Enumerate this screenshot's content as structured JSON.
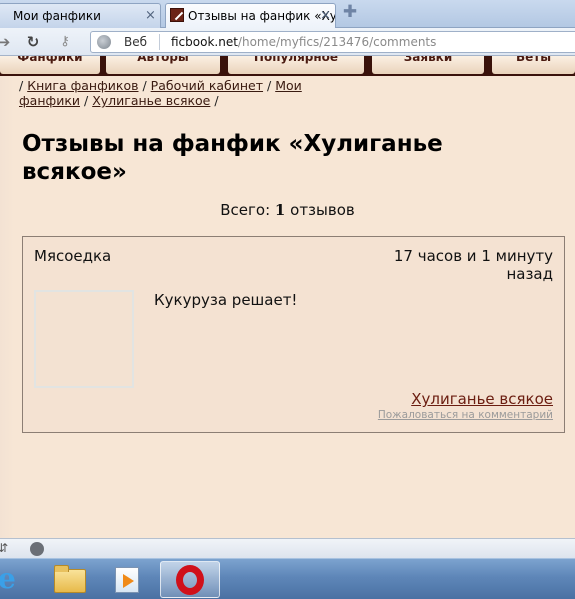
{
  "browser": {
    "tabs": [
      {
        "title": "Мои фанфики",
        "close": "×"
      },
      {
        "title": "Отзывы на фанфик «Хулиганье всякое»",
        "close": "×"
      }
    ],
    "new_tab": "✚",
    "address": {
      "mode_label": "Веб",
      "domain": "ficbook.net",
      "path": "/home/myfics/213476/comments"
    }
  },
  "site_nav": {
    "items": [
      {
        "label": "Фанфики"
      },
      {
        "label": "Авторы"
      },
      {
        "label": "Популярное"
      },
      {
        "label": "Заявки"
      },
      {
        "label": "Беты"
      }
    ]
  },
  "breadcrumb": {
    "sep": "/",
    "items": [
      "Книга фанфиков",
      "Рабочий кабинет",
      "Мои фанфики",
      "Хулиганье всякое"
    ]
  },
  "page": {
    "title": "Отзывы на фанфик «Хулиганье всякое»",
    "total_label": "Всего:",
    "total_count": "1",
    "total_suffix": "отзывов"
  },
  "reviews": [
    {
      "author": "Мясоедка",
      "time": "17 часов и 1 минуту назад",
      "text": "Кукуруза решает!",
      "fic_link": "Хулиганье всякое",
      "report_link": "Пожаловаться на комментарий"
    }
  ],
  "taskbar": {
    "items": [
      "internet-explorer",
      "windows-explorer",
      "media-player",
      "opera"
    ]
  },
  "colors": {
    "page_bg": "#f7e6d5",
    "site_nav_bg": "#3a120b",
    "link": "#6b1d10",
    "taskbar": "#5e86b8"
  }
}
